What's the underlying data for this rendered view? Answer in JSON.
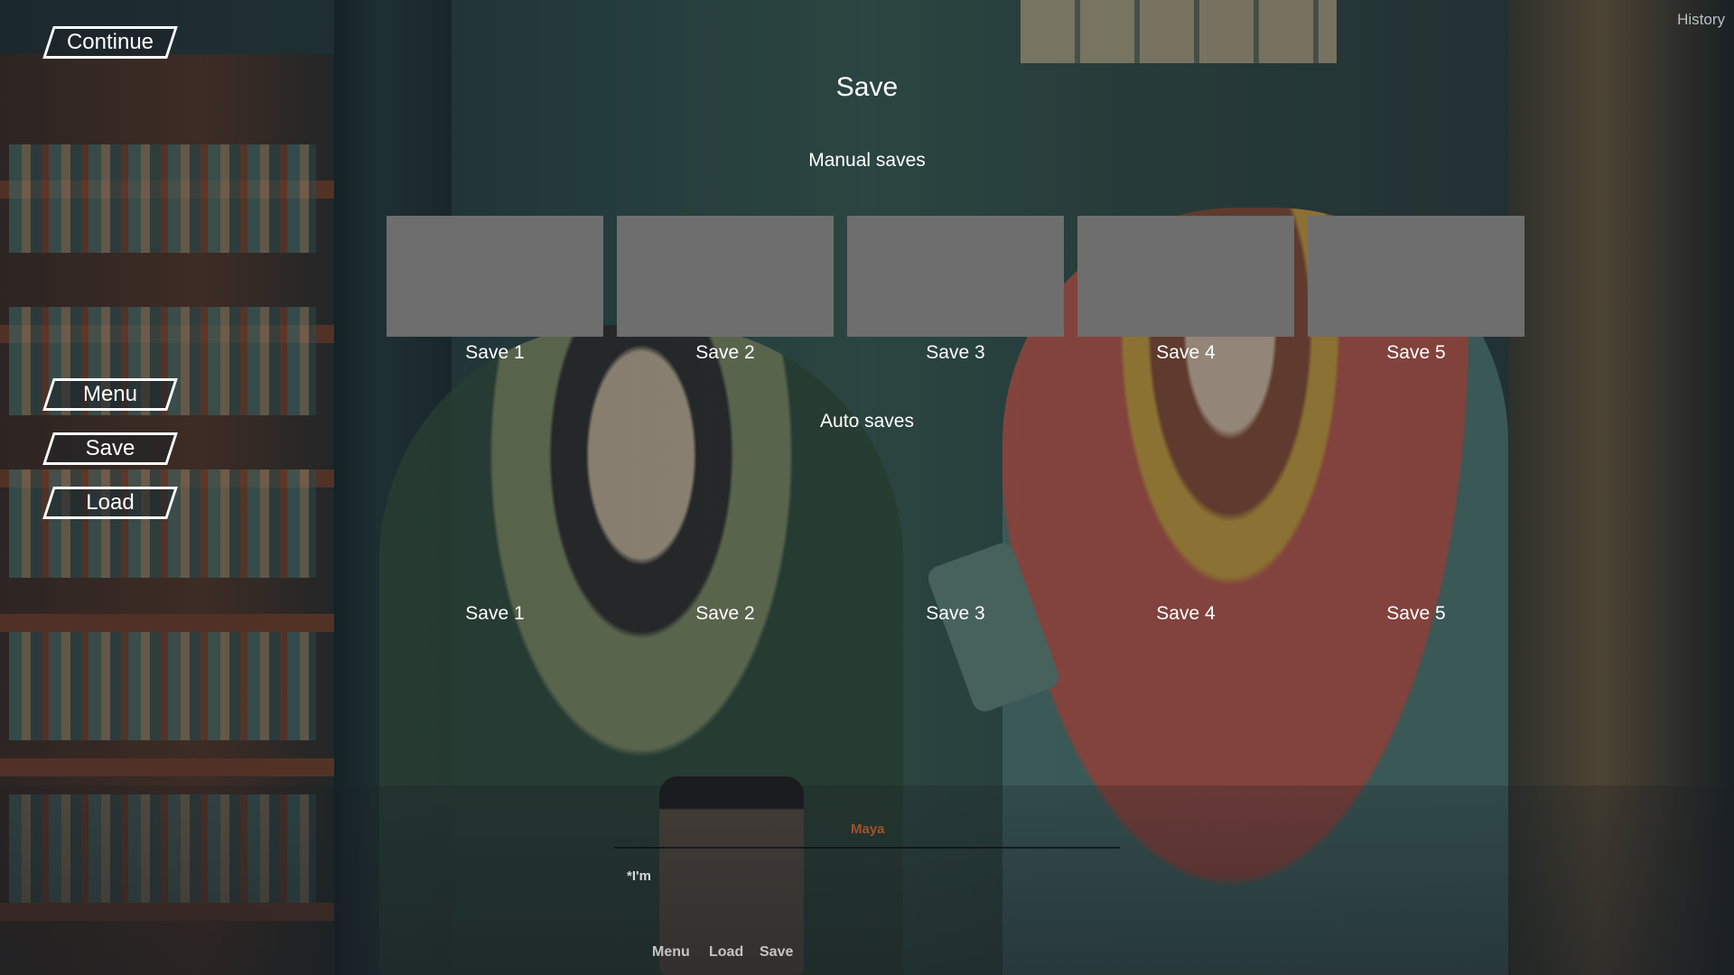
{
  "menu": {
    "continue": "Continue",
    "menu": "Menu",
    "save": "Save",
    "load": "Load"
  },
  "history": "History",
  "screen": {
    "title": "Save",
    "manual_label": "Manual saves",
    "auto_label": "Auto saves",
    "manual_slots": [
      "Save 1",
      "Save 2",
      "Save 3",
      "Save 4",
      "Save 5"
    ],
    "auto_slots": [
      "Save 1",
      "Save 2",
      "Save 3",
      "Save 4",
      "Save 5"
    ]
  },
  "dialogue": {
    "speaker": "Maya",
    "text": "*I'm"
  },
  "quick_menu": {
    "menu": "Menu",
    "load": "Load",
    "save": "Save"
  },
  "colors": {
    "speaker": "#a0522d",
    "slot_thumb": "#6e6e6e"
  }
}
